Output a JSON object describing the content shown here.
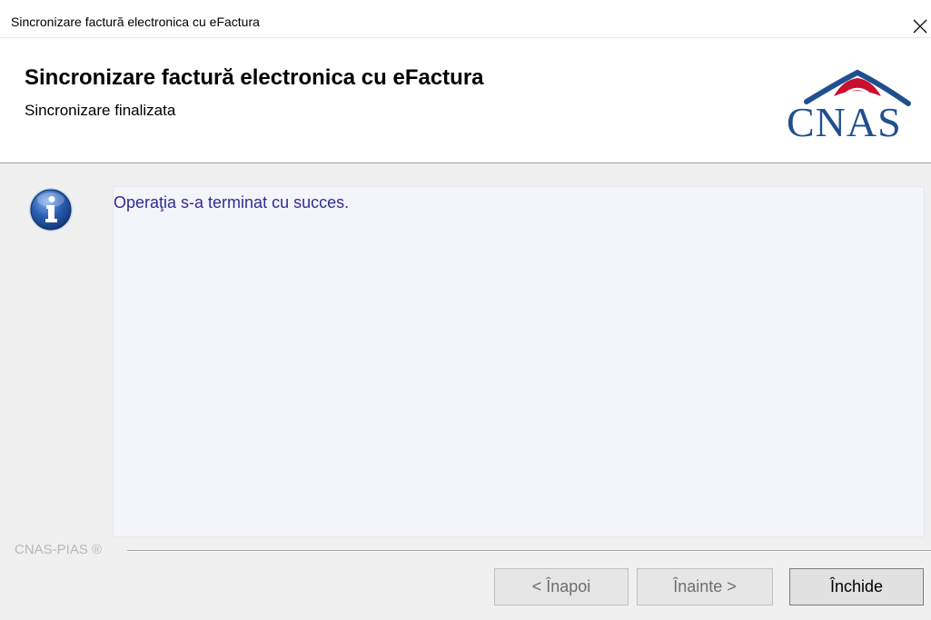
{
  "window": {
    "title": "Sincronizare factură electronica cu eFactura"
  },
  "header": {
    "title": "Sincronizare factură electronica cu eFactura",
    "subtitle": "Sincronizare finalizata",
    "logo_text": "CNAS"
  },
  "content": {
    "message": "Operaţia s-a terminat cu succes."
  },
  "footer": {
    "branding": "CNAS-PIAS ®"
  },
  "buttons": {
    "back_label": "< Înapoi",
    "next_label": "Înainte >",
    "close_label": "Închide"
  },
  "icons": {
    "close": "close-icon",
    "info": "info-icon",
    "logo": "cnas-logo"
  },
  "colors": {
    "message_text": "#2e2e92",
    "logo_blue": "#1f4f8f",
    "logo_red": "#c8102e",
    "info_blue": "#2a5db0"
  }
}
